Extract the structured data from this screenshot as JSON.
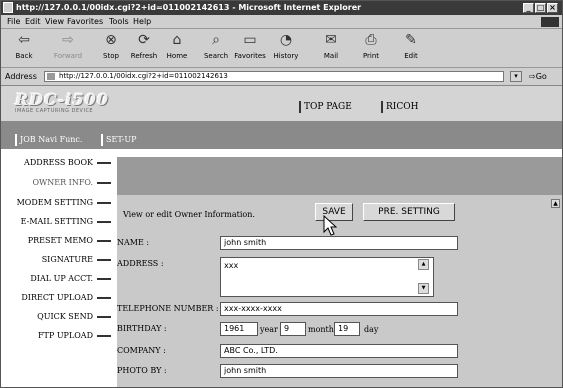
{
  "window": {
    "title": "http://127.0.0.1/00idx.cgi?2+id=011002142613 - Microsoft Internet Explorer"
  },
  "menu": [
    "File",
    "Edit",
    "View",
    "Favorites",
    "Tools",
    "Help"
  ],
  "toolbar": {
    "back": "Back",
    "forward": "Forward",
    "stop": "Stop",
    "refresh": "Refresh",
    "home": "Home",
    "search": "Search",
    "favorites": "Favorites",
    "history": "History",
    "mail": "Mail",
    "print": "Print",
    "edit": "Edit"
  },
  "address": {
    "label": "Address",
    "url": "http://127.0.0.1/00idx.cgi?2+id=011002142613",
    "go": "Go"
  },
  "header": {
    "logo": "RDC-i500",
    "logo_sub": "IMAGE CAPTURING DEVICE",
    "links": [
      "TOP PAGE",
      "RICOH"
    ],
    "tabs": [
      "JOB Navi Func.",
      "SET-UP"
    ]
  },
  "sidebar": [
    "ADDRESS BOOK",
    "OWNER INFO.",
    "MODEM SETTING",
    "E-MAIL SETTING",
    "PRESET MEMO",
    "SIGNATURE",
    "DIAL UP ACCT.",
    "DIRECT UPLOAD",
    "QUICK SEND",
    "FTP UPLOAD"
  ],
  "form": {
    "instruction": "View or edit Owner Information.",
    "save": "SAVE",
    "preset": "PRE. SETTING",
    "name_label": "NAME :",
    "name_value": "john smith",
    "address_label": "ADDRESS :",
    "address_value": "xxx",
    "telephone_label": "TELEPHONE NUMBER :",
    "telephone_value": "xxx-xxxx-xxxx",
    "birthday_label": "BIRTHDAY :",
    "birth_year": "1961",
    "year_label": "year",
    "birth_month": "9",
    "month_label": "month",
    "birth_day": "19",
    "day_label": "day",
    "company_label": "COMPANY :",
    "company_value": "ABC Co., LTD.",
    "photo_label": "PHOTO BY :",
    "photo_value": "john smith"
  }
}
